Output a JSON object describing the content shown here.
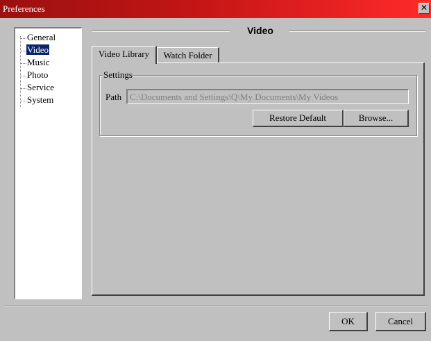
{
  "window": {
    "title": "Preferences",
    "close_glyph": "✕"
  },
  "tree": {
    "items": [
      {
        "label": "General",
        "selected": false
      },
      {
        "label": "Video",
        "selected": true
      },
      {
        "label": "Music",
        "selected": false
      },
      {
        "label": "Photo",
        "selected": false
      },
      {
        "label": "Service",
        "selected": false
      },
      {
        "label": "System",
        "selected": false
      }
    ]
  },
  "section": {
    "title": "Video"
  },
  "tabs": [
    {
      "label": "Video Library",
      "active": true
    },
    {
      "label": "Watch Folder",
      "active": false
    }
  ],
  "settings": {
    "group_label": "Settings",
    "path_label": "Path",
    "path_value": "C:\\Documents and Settings\\Q\\My Documents\\My Videos",
    "restore_label": "Restore Default",
    "browse_label": "Browse..."
  },
  "footer": {
    "ok_label": "OK",
    "cancel_label": "Cancel"
  },
  "colors": {
    "titlebar": "#c41515",
    "selection": "#0a246a",
    "face": "#c0c0c0"
  }
}
